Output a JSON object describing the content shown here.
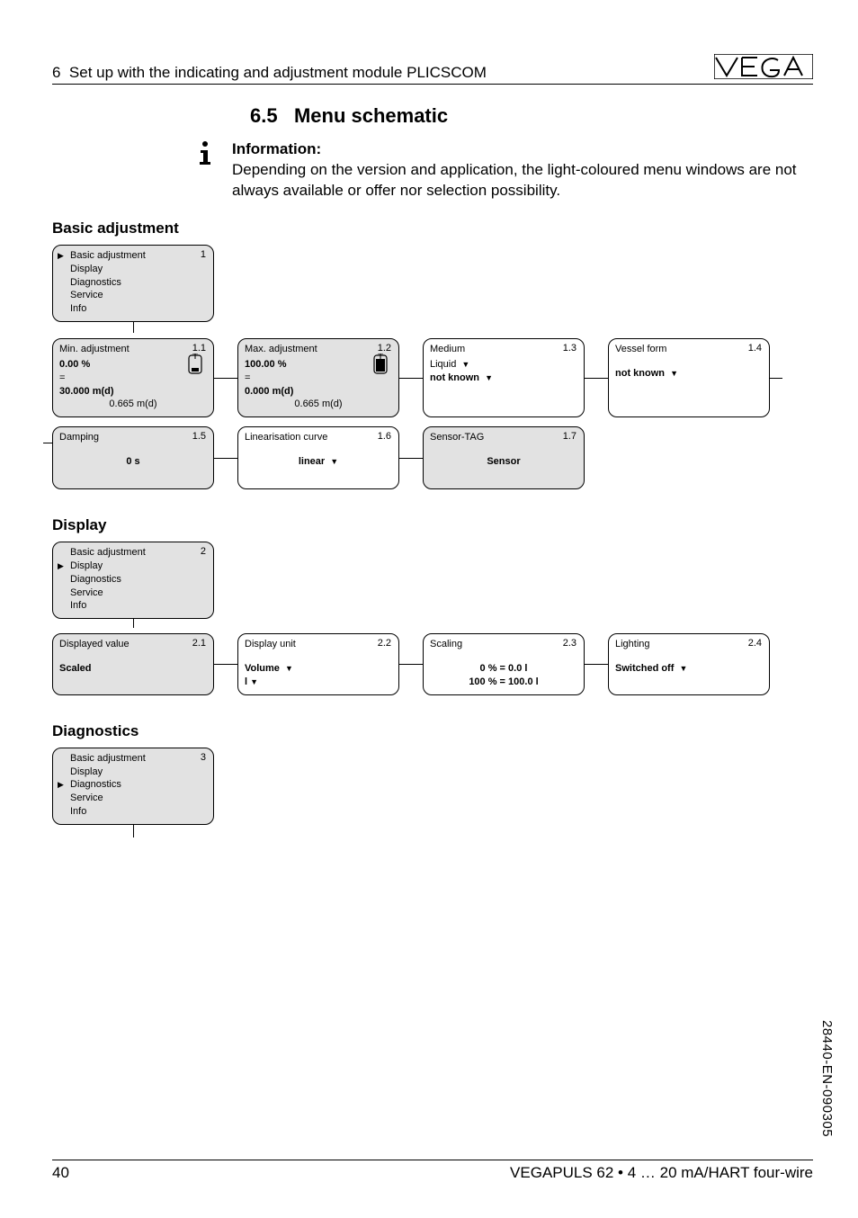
{
  "header": {
    "section_no": "6",
    "section_title": "Set up with the indicating and adjustment module PLICSCOM"
  },
  "logo_text": "VEGA",
  "heading": {
    "num": "6.5",
    "title": "Menu schematic"
  },
  "info": {
    "label": "Information:",
    "body": "Depending on the version and application, the light-coloured menu windows are not always available or offer nor selection possibility."
  },
  "groups": {
    "basic": {
      "heading": "Basic adjustment",
      "root": {
        "num": "1",
        "items": [
          "Basic adjustment",
          "Display",
          "Diagnostics",
          "Service",
          "Info"
        ],
        "selected": 0
      },
      "row1": [
        {
          "num": "1.1",
          "title": "Min. adjustment",
          "v1": "0.00 %",
          "eq": "=",
          "v2": "30.000 m(d)",
          "v3": "0.665 m(d)"
        },
        {
          "num": "1.2",
          "title": "Max. adjustment",
          "v1": "100.00 %",
          "eq": "=",
          "v2": "0.000 m(d)",
          "v3": "0.665 m(d)"
        },
        {
          "num": "1.3",
          "title": "Medium",
          "v1": "Liquid",
          "v2": "not known"
        },
        {
          "num": "1.4",
          "title": "Vessel form",
          "v1": "not known"
        }
      ],
      "row2": [
        {
          "num": "1.5",
          "title": "Damping",
          "v1": "0 s"
        },
        {
          "num": "1.6",
          "title": "Linearisation curve",
          "v1": "linear"
        },
        {
          "num": "1.7",
          "title": "Sensor-TAG",
          "v1": "Sensor"
        }
      ]
    },
    "display": {
      "heading": "Display",
      "root": {
        "num": "2",
        "items": [
          "Basic adjustment",
          "Display",
          "Diagnostics",
          "Service",
          "Info"
        ],
        "selected": 1
      },
      "row1": [
        {
          "num": "2.1",
          "title": "Displayed value",
          "v1": "Scaled"
        },
        {
          "num": "2.2",
          "title": "Display unit",
          "v1": "Volume",
          "v2": "l"
        },
        {
          "num": "2.3",
          "title": "Scaling",
          "v1": "0 % = 0.0 l",
          "v2": "100 % = 100.0 l"
        },
        {
          "num": "2.4",
          "title": "Lighting",
          "v1": "Switched off"
        }
      ]
    },
    "diag": {
      "heading": "Diagnostics",
      "root": {
        "num": "3",
        "items": [
          "Basic adjustment",
          "Display",
          "Diagnostics",
          "Service",
          "Info"
        ],
        "selected": 2
      }
    }
  },
  "footer": {
    "page": "40",
    "product": "VEGAPULS 62 • 4 … 20 mA/HART four-wire"
  },
  "side": "28440-EN-090305"
}
